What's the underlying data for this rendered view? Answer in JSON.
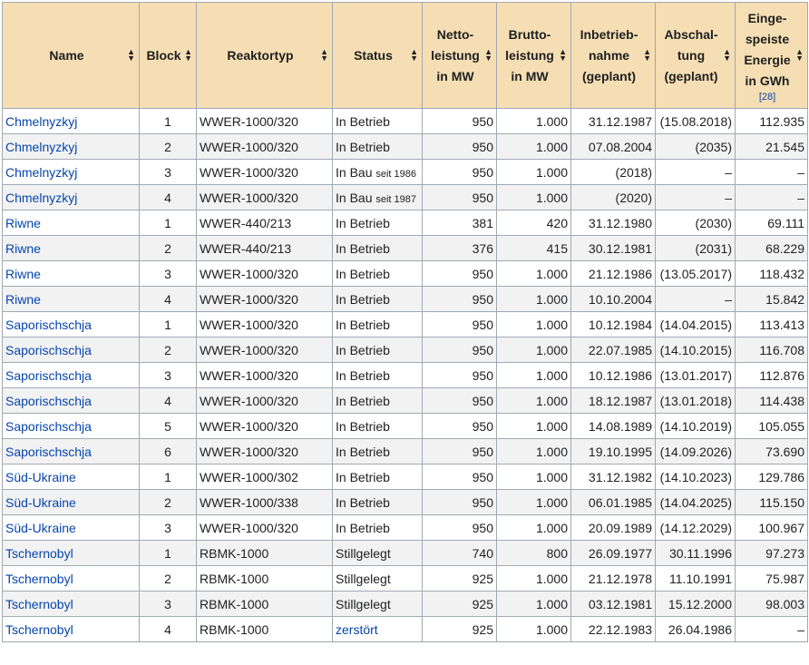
{
  "headers": {
    "name": "Name",
    "block": "Block",
    "reactor_type": "Reaktortyp",
    "status": "Status",
    "net_1": "Netto-",
    "net_2": "leistung",
    "net_3": "in MW",
    "gross_1": "Brutto-",
    "gross_2": "leistung",
    "gross_3": "in MW",
    "start_1": "Inbetrieb-",
    "start_2": "nahme",
    "start_3": "(geplant)",
    "shutdown_1": "Abschal-",
    "shutdown_2": "tung",
    "shutdown_3": "(geplant)",
    "energy_1": "Einge-",
    "energy_2": "speiste",
    "energy_3": "Energie",
    "energy_4": "in GWh",
    "energy_ref": "[28]"
  },
  "rows": [
    {
      "name": "Chmelnyzkyj",
      "block": "1",
      "type": "WWER-1000/320",
      "status": "In Betrieb",
      "status_note": "",
      "net": "950",
      "gross": "1.000",
      "start": "31.12.1987",
      "shutdown": "(15.08.2018)",
      "energy": "112.935"
    },
    {
      "name": "Chmelnyzkyj",
      "block": "2",
      "type": "WWER-1000/320",
      "status": "In Betrieb",
      "status_note": "",
      "net": "950",
      "gross": "1.000",
      "start": "07.08.2004",
      "shutdown": "(2035)",
      "energy": "21.545"
    },
    {
      "name": "Chmelnyzkyj",
      "block": "3",
      "type": "WWER-1000/320",
      "status": "In Bau",
      "status_note": "seit 1986",
      "net": "950",
      "gross": "1.000",
      "start": "(2018)",
      "shutdown": "–",
      "energy": "–"
    },
    {
      "name": "Chmelnyzkyj",
      "block": "4",
      "type": "WWER-1000/320",
      "status": "In Bau",
      "status_note": "seit 1987",
      "net": "950",
      "gross": "1.000",
      "start": "(2020)",
      "shutdown": "–",
      "energy": "–"
    },
    {
      "name": "Riwne",
      "block": "1",
      "type": "WWER-440/213",
      "status": "In Betrieb",
      "status_note": "",
      "net": "381",
      "gross": "420",
      "start": "31.12.1980",
      "shutdown": "(2030)",
      "energy": "69.111"
    },
    {
      "name": "Riwne",
      "block": "2",
      "type": "WWER-440/213",
      "status": "In Betrieb",
      "status_note": "",
      "net": "376",
      "gross": "415",
      "start": "30.12.1981",
      "shutdown": "(2031)",
      "energy": "68.229"
    },
    {
      "name": "Riwne",
      "block": "3",
      "type": "WWER-1000/320",
      "status": "In Betrieb",
      "status_note": "",
      "net": "950",
      "gross": "1.000",
      "start": "21.12.1986",
      "shutdown": "(13.05.2017)",
      "energy": "118.432"
    },
    {
      "name": "Riwne",
      "block": "4",
      "type": "WWER-1000/320",
      "status": "In Betrieb",
      "status_note": "",
      "net": "950",
      "gross": "1.000",
      "start": "10.10.2004",
      "shutdown": "–",
      "energy": "15.842"
    },
    {
      "name": "Saporischschja",
      "block": "1",
      "type": "WWER-1000/320",
      "status": "In Betrieb",
      "status_note": "",
      "net": "950",
      "gross": "1.000",
      "start": "10.12.1984",
      "shutdown": "(14.04.2015)",
      "energy": "113.413"
    },
    {
      "name": "Saporischschja",
      "block": "2",
      "type": "WWER-1000/320",
      "status": "In Betrieb",
      "status_note": "",
      "net": "950",
      "gross": "1.000",
      "start": "22.07.1985",
      "shutdown": "(14.10.2015)",
      "energy": "116.708"
    },
    {
      "name": "Saporischschja",
      "block": "3",
      "type": "WWER-1000/320",
      "status": "In Betrieb",
      "status_note": "",
      "net": "950",
      "gross": "1.000",
      "start": "10.12.1986",
      "shutdown": "(13.01.2017)",
      "energy": "112.876"
    },
    {
      "name": "Saporischschja",
      "block": "4",
      "type": "WWER-1000/320",
      "status": "In Betrieb",
      "status_note": "",
      "net": "950",
      "gross": "1.000",
      "start": "18.12.1987",
      "shutdown": "(13.01.2018)",
      "energy": "114.438"
    },
    {
      "name": "Saporischschja",
      "block": "5",
      "type": "WWER-1000/320",
      "status": "In Betrieb",
      "status_note": "",
      "net": "950",
      "gross": "1.000",
      "start": "14.08.1989",
      "shutdown": "(14.10.2019)",
      "energy": "105.055"
    },
    {
      "name": "Saporischschja",
      "block": "6",
      "type": "WWER-1000/320",
      "status": "In Betrieb",
      "status_note": "",
      "net": "950",
      "gross": "1.000",
      "start": "19.10.1995",
      "shutdown": "(14.09.2026)",
      "energy": "73.690"
    },
    {
      "name": "Süd-Ukraine",
      "block": "1",
      "type": "WWER-1000/302",
      "status": "In Betrieb",
      "status_note": "",
      "net": "950",
      "gross": "1.000",
      "start": "31.12.1982",
      "shutdown": "(14.10.2023)",
      "energy": "129.786"
    },
    {
      "name": "Süd-Ukraine",
      "block": "2",
      "type": "WWER-1000/338",
      "status": "In Betrieb",
      "status_note": "",
      "net": "950",
      "gross": "1.000",
      "start": "06.01.1985",
      "shutdown": "(14.04.2025)",
      "energy": "115.150"
    },
    {
      "name": "Süd-Ukraine",
      "block": "3",
      "type": "WWER-1000/320",
      "status": "In Betrieb",
      "status_note": "",
      "net": "950",
      "gross": "1.000",
      "start": "20.09.1989",
      "shutdown": "(14.12.2029)",
      "energy": "100.967"
    },
    {
      "name": "Tschernobyl",
      "block": "1",
      "type": "RBMK-1000",
      "status": "Stillgelegt",
      "status_note": "",
      "net": "740",
      "gross": "800",
      "start": "26.09.1977",
      "shutdown": "30.11.1996",
      "energy": "97.273"
    },
    {
      "name": "Tschernobyl",
      "block": "2",
      "type": "RBMK-1000",
      "status": "Stillgelegt",
      "status_note": "",
      "net": "925",
      "gross": "1.000",
      "start": "21.12.1978",
      "shutdown": "11.10.1991",
      "energy": "75.987"
    },
    {
      "name": "Tschernobyl",
      "block": "3",
      "type": "RBMK-1000",
      "status": "Stillgelegt",
      "status_note": "",
      "net": "925",
      "gross": "1.000",
      "start": "03.12.1981",
      "shutdown": "15.12.2000",
      "energy": "98.003"
    },
    {
      "name": "Tschernobyl",
      "block": "4",
      "type": "RBMK-1000",
      "status": "zerstört",
      "status_note": "",
      "net": "925",
      "gross": "1.000",
      "start": "22.12.1983",
      "shutdown": "26.04.1986",
      "energy": "–"
    }
  ],
  "colors": {
    "header_bg": "#f5deb3",
    "link": "#0645ad",
    "border": "#a2a9b1"
  },
  "icons": {
    "sort": "sort-arrows-icon"
  }
}
